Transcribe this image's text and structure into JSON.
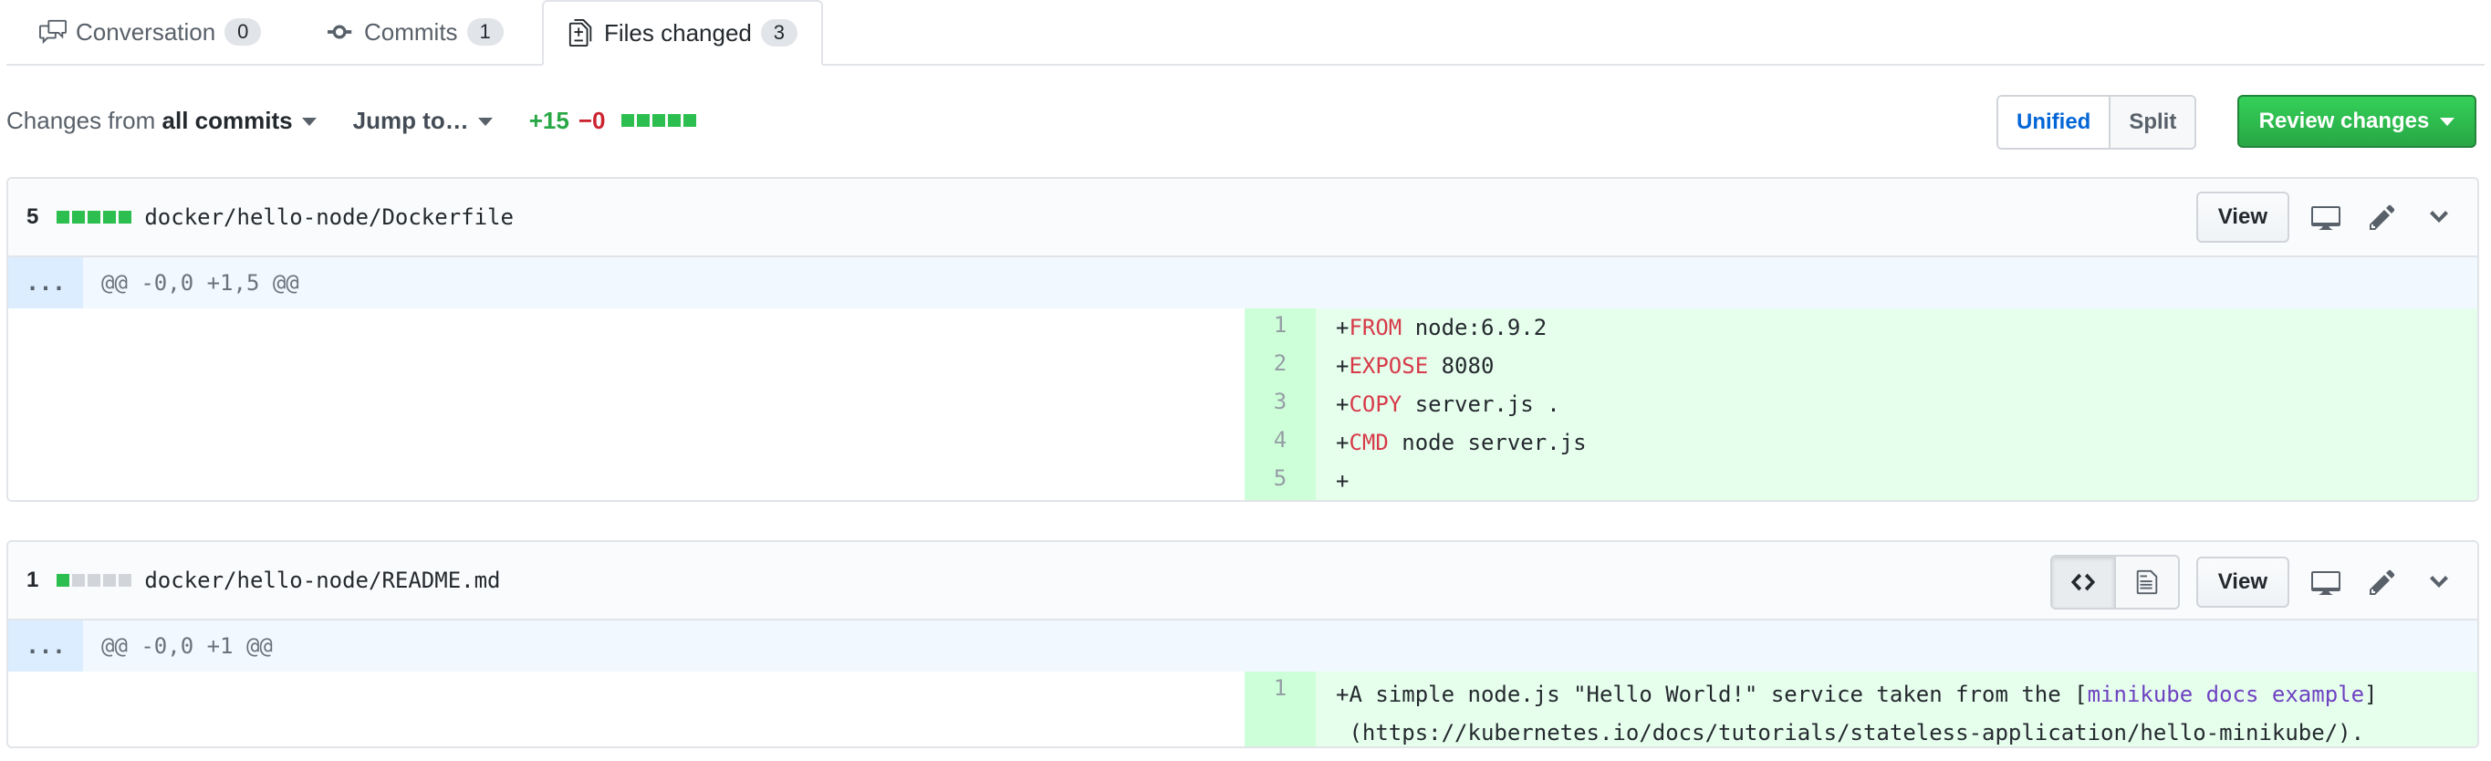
{
  "tabs": [
    {
      "label": "Conversation",
      "count": "0"
    },
    {
      "label": "Commits",
      "count": "1"
    },
    {
      "label": "Files changed",
      "count": "3"
    }
  ],
  "toolbar": {
    "changes_prefix": "Changes from",
    "changes_value": "all commits",
    "jump": "Jump to…",
    "additions": "+15",
    "deletions": "−0",
    "view_unified": "Unified",
    "view_split": "Split",
    "review": "Review changes"
  },
  "files": [
    {
      "count": "5",
      "path": "docker/hello-node/Dockerfile",
      "view_label": "View",
      "hunk_expand": "...",
      "hunk": "@@ -0,0 +1,5 @@",
      "lines": [
        {
          "num": "1",
          "plus": "+",
          "kw": "FROM",
          "rest": " node:6.9.2"
        },
        {
          "num": "2",
          "plus": "+",
          "kw": "EXPOSE",
          "rest": " 8080"
        },
        {
          "num": "3",
          "plus": "+",
          "kw": "COPY",
          "rest": " server.js ."
        },
        {
          "num": "4",
          "plus": "+",
          "kw": "CMD",
          "rest": " node server.js"
        },
        {
          "num": "5",
          "plus": "+",
          "kw": "",
          "rest": ""
        }
      ]
    },
    {
      "count": "1",
      "path": "docker/hello-node/README.md",
      "view_label": "View",
      "hunk_expand": "...",
      "hunk": "@@ -0,0 +1 @@",
      "line": {
        "num": "1",
        "pre": "+A simple node.js \"Hello World!\" service taken from the [",
        "link": "minikube docs example",
        "post": "]",
        "cont": " (https://kubernetes.io/docs/tutorials/stateless-application/hello-minikube/)."
      }
    }
  ]
}
